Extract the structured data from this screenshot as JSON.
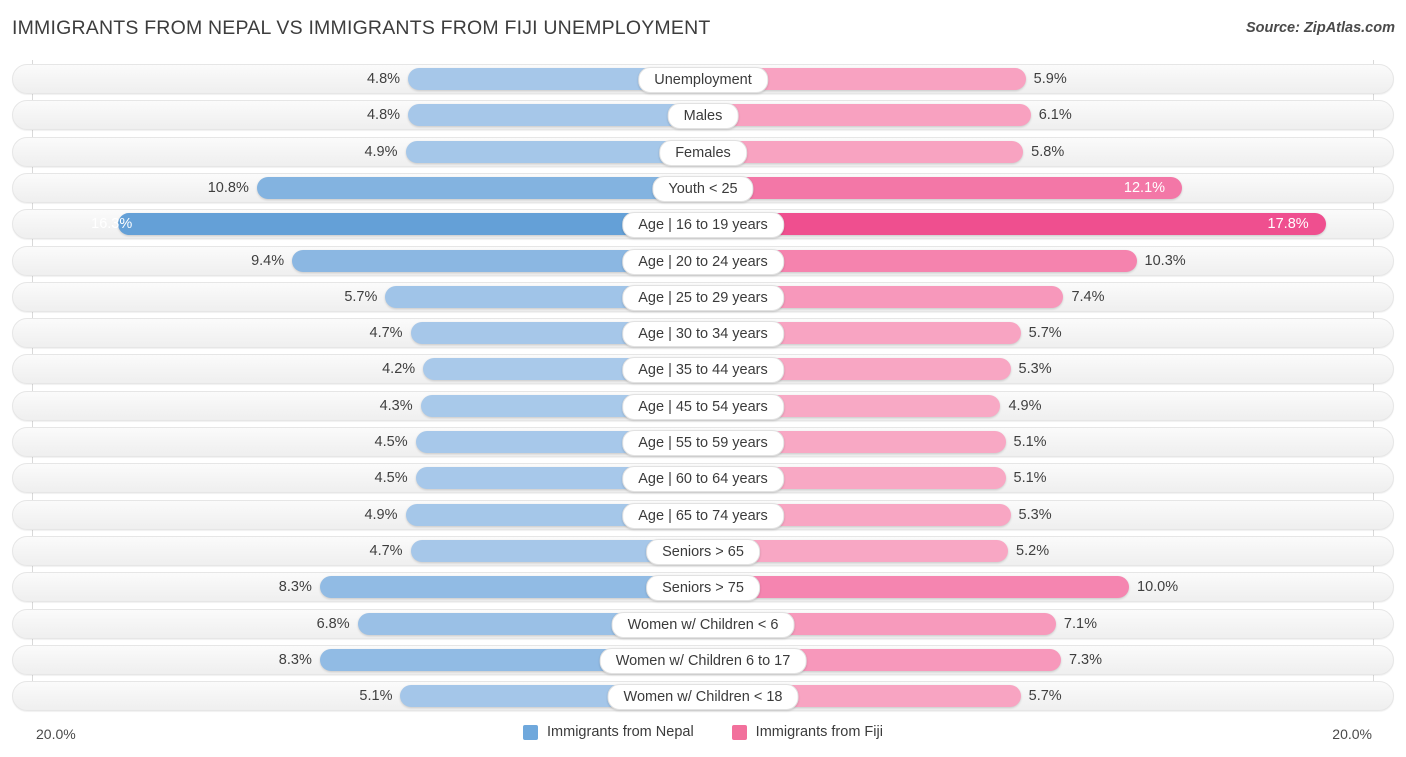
{
  "header": {
    "title": "IMMIGRANTS FROM NEPAL VS IMMIGRANTS FROM FIJI UNEMPLOYMENT",
    "source": "Source: ZipAtlas.com"
  },
  "footer": {
    "axis_left": "20.0%",
    "axis_right": "20.0%",
    "legend": [
      {
        "label": "Immigrants from Nepal",
        "color": "#6fa8dc"
      },
      {
        "label": "Immigrants from Fiji",
        "color": "#f2709c"
      }
    ]
  },
  "colors": {
    "left_min": "#a9c9ea",
    "left_max": "#5b9bd5",
    "right_min": "#f9aec8",
    "right_max": "#ef4f8f",
    "track": "#f4f4f4",
    "gridline": "#d9d9d9"
  },
  "chart_data": {
    "type": "bar",
    "orientation": "diverging-horizontal",
    "title": "IMMIGRANTS FROM NEPAL VS IMMIGRANTS FROM FIJI UNEMPLOYMENT",
    "xlabel": "",
    "ylabel": "",
    "axis_max_percent": 20.0,
    "grid": true,
    "legend_position": "bottom-center",
    "categories": [
      "Unemployment",
      "Males",
      "Females",
      "Youth < 25",
      "Age | 16 to 19 years",
      "Age | 20 to 24 years",
      "Age | 25 to 29 years",
      "Age | 30 to 34 years",
      "Age | 35 to 44 years",
      "Age | 45 to 54 years",
      "Age | 55 to 59 years",
      "Age | 60 to 64 years",
      "Age | 65 to 74 years",
      "Seniors > 65",
      "Seniors > 75",
      "Women w/ Children < 6",
      "Women w/ Children 6 to 17",
      "Women w/ Children < 18"
    ],
    "series": [
      {
        "name": "Immigrants from Nepal",
        "side": "left",
        "values": [
          4.8,
          4.8,
          4.9,
          10.8,
          16.3,
          9.4,
          5.7,
          4.7,
          4.2,
          4.3,
          4.5,
          4.5,
          4.9,
          4.7,
          8.3,
          6.8,
          8.3,
          5.1
        ],
        "labels": [
          "4.8%",
          "4.8%",
          "4.9%",
          "10.8%",
          "16.3%",
          "9.4%",
          "5.7%",
          "4.7%",
          "4.2%",
          "4.3%",
          "4.5%",
          "4.5%",
          "4.9%",
          "4.7%",
          "8.3%",
          "6.8%",
          "8.3%",
          "5.1%"
        ]
      },
      {
        "name": "Immigrants from Fiji",
        "side": "right",
        "values": [
          5.9,
          6.1,
          5.8,
          12.1,
          17.8,
          10.3,
          7.4,
          5.7,
          5.3,
          4.9,
          5.1,
          5.1,
          5.3,
          5.2,
          10.0,
          7.1,
          7.3,
          5.7
        ],
        "labels": [
          "5.9%",
          "6.1%",
          "5.8%",
          "12.1%",
          "17.8%",
          "10.3%",
          "7.4%",
          "5.7%",
          "5.3%",
          "4.9%",
          "5.1%",
          "5.1%",
          "5.3%",
          "5.2%",
          "10.0%",
          "7.1%",
          "7.3%",
          "5.7%"
        ]
      }
    ]
  }
}
